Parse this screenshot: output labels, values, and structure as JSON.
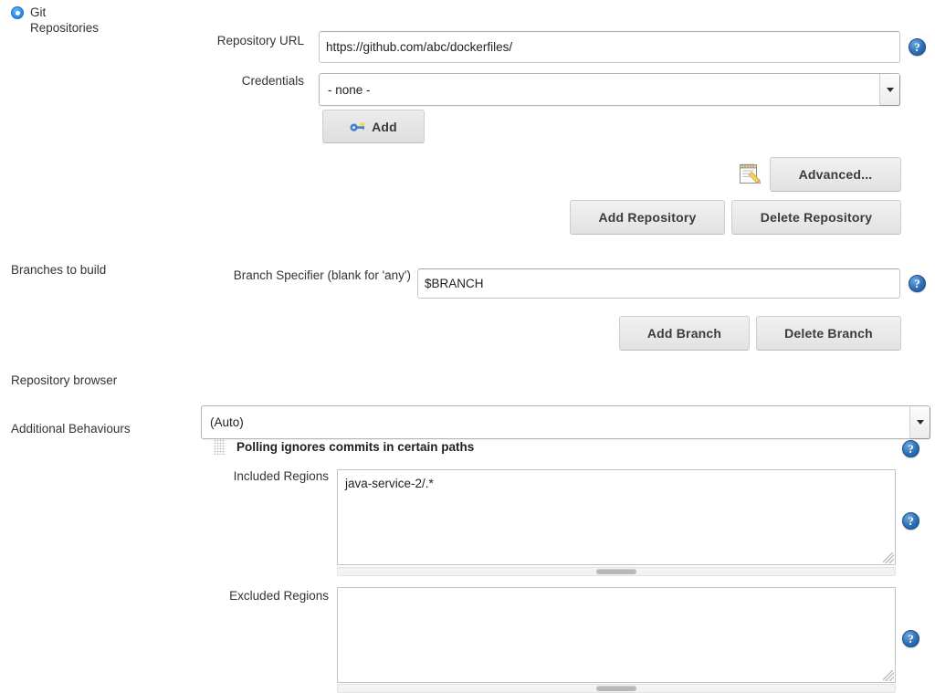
{
  "form": {
    "source_control": {
      "radio_label": "Git\nRepositories",
      "radio_selected": true,
      "repository_url": {
        "label": "Repository URL",
        "value": "https://github.com/abc/dockerfiles/",
        "placeholder": ""
      },
      "credentials": {
        "label": "Credentials",
        "selected": "- none -",
        "options": [
          "- none -"
        ],
        "add_button": "Add",
        "add_icon": "key-icon"
      },
      "advanced_button": "Advanced...",
      "advanced_icon": "notepad-pencil-icon",
      "add_repository_button": "Add Repository",
      "delete_repository_button": "Delete Repository"
    },
    "branches": {
      "section_label": "Branches to build",
      "branch_specifier": {
        "label": "Branch Specifier (blank for 'any')",
        "value": "$BRANCH",
        "placeholder": ""
      },
      "add_branch_button": "Add Branch",
      "delete_branch_button": "Delete Branch"
    },
    "repository_browser": {
      "section_label": "Repository browser",
      "selected": "(Auto)",
      "options": [
        "(Auto)"
      ]
    },
    "additional_behaviours": {
      "section_label": "Additional Behaviours",
      "behaviour": {
        "title": "Polling ignores commits in certain paths",
        "drag_handle_icon": "drag-handle-icon",
        "included_regions": {
          "label": "Included Regions",
          "value": "java-service-2/.*",
          "placeholder": ""
        },
        "excluded_regions": {
          "label": "Excluded Regions",
          "value": "",
          "placeholder": ""
        }
      }
    },
    "help_icon_glyph": "?"
  }
}
